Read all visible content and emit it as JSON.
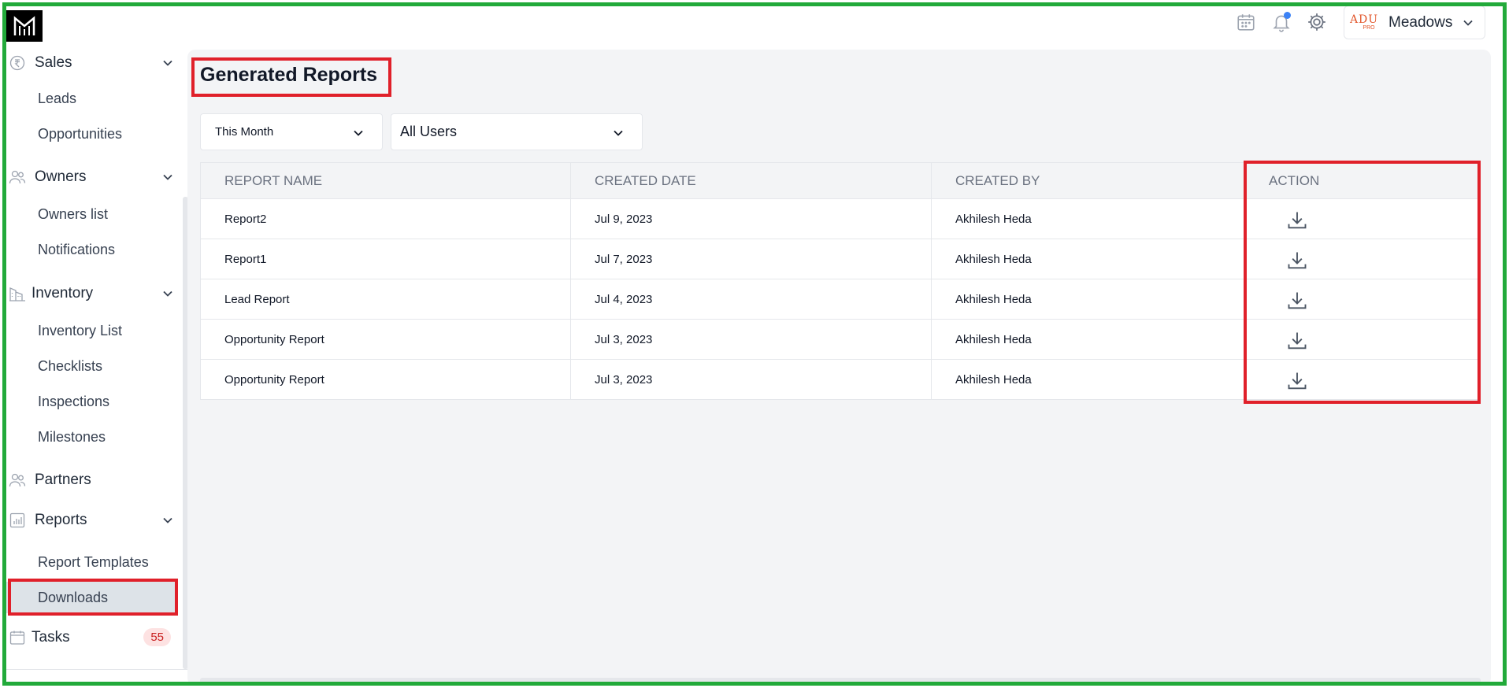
{
  "app": {
    "logo_icon": "building-logo-icon"
  },
  "header": {
    "icons": [
      "calendar-icon",
      "bell-icon",
      "gear-icon"
    ],
    "notification_dot_color": "#3b82f6",
    "user": {
      "avatar_text_top": "ADU",
      "avatar_text_bottom": "PRO",
      "name": "Meadows"
    }
  },
  "sidebar": {
    "sales": {
      "label": "Sales",
      "items": [
        "Leads",
        "Opportunities"
      ]
    },
    "owners": {
      "label": "Owners",
      "items": [
        "Owners list",
        "Notifications"
      ]
    },
    "inventory": {
      "label": "Inventory",
      "items": [
        "Inventory List",
        "Checklists",
        "Inspections",
        "Milestones"
      ]
    },
    "partners": {
      "label": "Partners"
    },
    "reports": {
      "label": "Reports",
      "items": [
        "Report Templates",
        "Downloads"
      ],
      "active": "Downloads"
    },
    "tasks": {
      "label": "Tasks",
      "badge": "55"
    }
  },
  "main": {
    "title": "Generated Reports",
    "filters": {
      "period": "This Month",
      "users": "All Users"
    },
    "table": {
      "headers": [
        "REPORT NAME",
        "CREATED DATE",
        "CREATED BY",
        "ACTION"
      ],
      "rows": [
        {
          "name": "Report2",
          "date": "Jul 9, 2023",
          "by": "Akhilesh Heda"
        },
        {
          "name": "Report1",
          "date": "Jul 7, 2023",
          "by": "Akhilesh Heda"
        },
        {
          "name": "Lead Report",
          "date": "Jul 4, 2023",
          "by": "Akhilesh Heda"
        },
        {
          "name": "Opportunity Report",
          "date": "Jul 3, 2023",
          "by": "Akhilesh Heda"
        },
        {
          "name": "Opportunity Report",
          "date": "Jul 3, 2023",
          "by": "Akhilesh Heda"
        }
      ]
    }
  },
  "colors": {
    "frame": "#22aa3a",
    "highlight": "#e0202a",
    "accent": "#3b82f6"
  }
}
